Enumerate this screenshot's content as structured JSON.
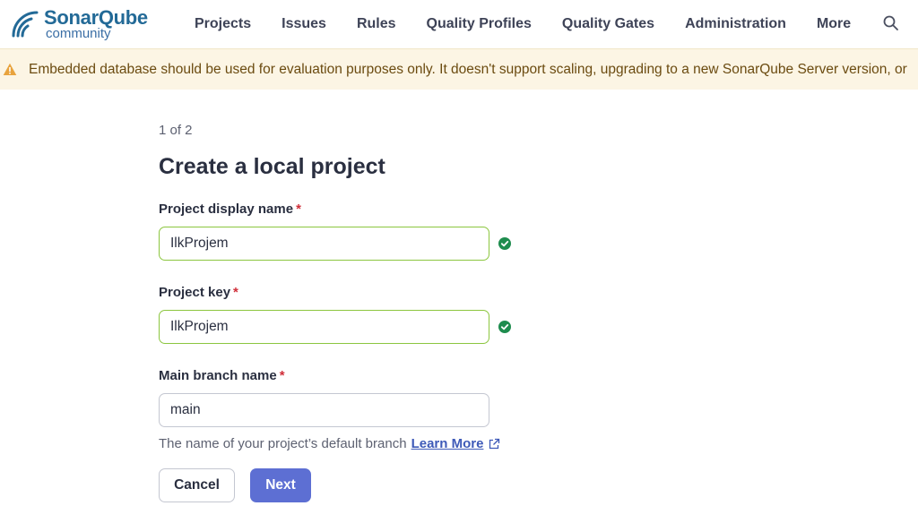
{
  "header": {
    "logo_name": "SonarQube",
    "logo_edition": "community",
    "nav": [
      {
        "label": "Projects"
      },
      {
        "label": "Issues"
      },
      {
        "label": "Rules"
      },
      {
        "label": "Quality Profiles"
      },
      {
        "label": "Quality Gates"
      },
      {
        "label": "Administration"
      },
      {
        "label": "More"
      }
    ],
    "search_icon": "search-icon"
  },
  "banner": {
    "icon": "warning-icon",
    "text": "Embedded database should be used for evaluation purposes only. It doesn't support scaling, upgrading to a new SonarQube Server version, or"
  },
  "form": {
    "step": "1 of 2",
    "title": "Create a local project",
    "required_mark": "*",
    "fields": [
      {
        "label": "Project display name",
        "value": "IlkProjem",
        "status": "valid"
      },
      {
        "label": "Project key",
        "value": "IlkProjem",
        "status": "valid"
      },
      {
        "label": "Main branch name",
        "value": "main",
        "status": "none"
      }
    ],
    "help_text": "The name of your project’s default branch",
    "help_link": "Learn More",
    "cancel_label": "Cancel",
    "next_label": "Next"
  },
  "colors": {
    "primary": "#5d6fd3",
    "valid": "#1e8c4e",
    "banner_bg": "#fcf5e4",
    "warning": "#e8a33d"
  }
}
